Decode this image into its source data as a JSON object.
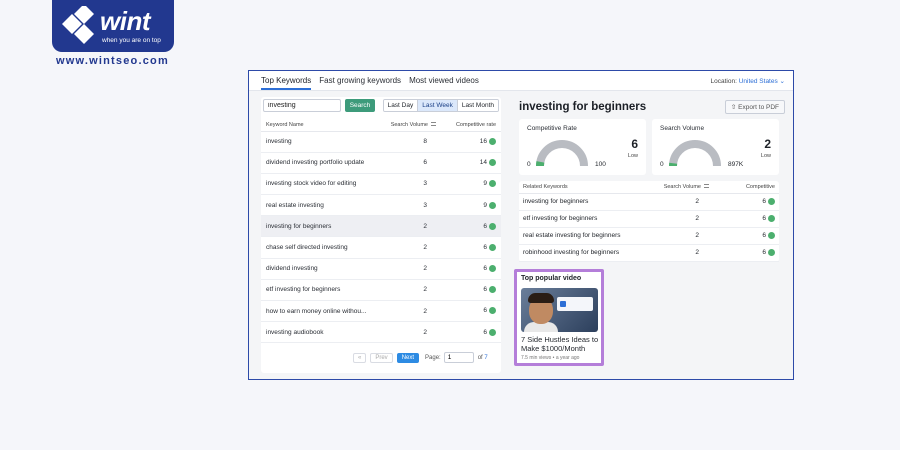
{
  "brand": {
    "name": "wint",
    "tagline": "when you are on top",
    "url": "www.wintseo.com"
  },
  "tabs": [
    {
      "label": "Top Keywords",
      "active": true
    },
    {
      "label": "Fast growing keywords",
      "active": false
    },
    {
      "label": "Most viewed videos",
      "active": false
    }
  ],
  "location": {
    "label": "Location:",
    "value": "United States"
  },
  "search": {
    "value": "investing",
    "button": "Search"
  },
  "periods": [
    {
      "label": "Last Day",
      "active": false
    },
    {
      "label": "Last Week",
      "active": true
    },
    {
      "label": "Last Month",
      "active": false
    }
  ],
  "keyword_table": {
    "headers": [
      "Keyword Name",
      "Search Volume",
      "Competitive rate"
    ],
    "rows": [
      {
        "name": "investing",
        "volume": "8",
        "rate": "16"
      },
      {
        "name": "dividend investing portfolio update",
        "volume": "6",
        "rate": "14"
      },
      {
        "name": "investing stock video for editing",
        "volume": "3",
        "rate": "9"
      },
      {
        "name": "real estate investing",
        "volume": "3",
        "rate": "9"
      },
      {
        "name": "investing for beginners",
        "volume": "2",
        "rate": "6",
        "selected": true
      },
      {
        "name": "chase self directed investing",
        "volume": "2",
        "rate": "6"
      },
      {
        "name": "dividend investing",
        "volume": "2",
        "rate": "6"
      },
      {
        "name": "etf investing for beginners",
        "volume": "2",
        "rate": "6"
      },
      {
        "name": "how to earn money online withou...",
        "volume": "2",
        "rate": "6"
      },
      {
        "name": "investing audiobook",
        "volume": "2",
        "rate": "6"
      }
    ]
  },
  "pager": {
    "prev": "Prev",
    "next": "Next",
    "page_label": "Page:",
    "page": "1",
    "of_label": "of",
    "total": "7"
  },
  "detail": {
    "title": "investing for beginners",
    "export": "Export to PDF",
    "competitive": {
      "title": "Competitive Rate",
      "value": "6",
      "level": "Low",
      "min": "0",
      "max": "100",
      "fraction": 0.06
    },
    "volume": {
      "title": "Search Volume",
      "value": "2",
      "level": "Low",
      "min": "0",
      "max": "897K",
      "fraction": 0.03
    },
    "related": {
      "headers": [
        "Related Keywords",
        "Search Volume",
        "Competitive"
      ],
      "rows": [
        {
          "name": "investing for beginners",
          "volume": "2",
          "rate": "6"
        },
        {
          "name": "etf investing for beginners",
          "volume": "2",
          "rate": "6"
        },
        {
          "name": "real estate investing for beginners",
          "volume": "2",
          "rate": "6"
        },
        {
          "name": "robinhood investing for beginners",
          "volume": "2",
          "rate": "6"
        }
      ]
    }
  },
  "popular": {
    "title": "Top popular video",
    "video_title": "7 Side Hustles Ideas to Make $1000/Month",
    "meta": "7.5 min views • a year ago"
  },
  "colors": {
    "accent": "#2d6fd6",
    "brand": "#22388f",
    "status_green": "#4caf6e",
    "highlight_border": "#b47ed9"
  }
}
